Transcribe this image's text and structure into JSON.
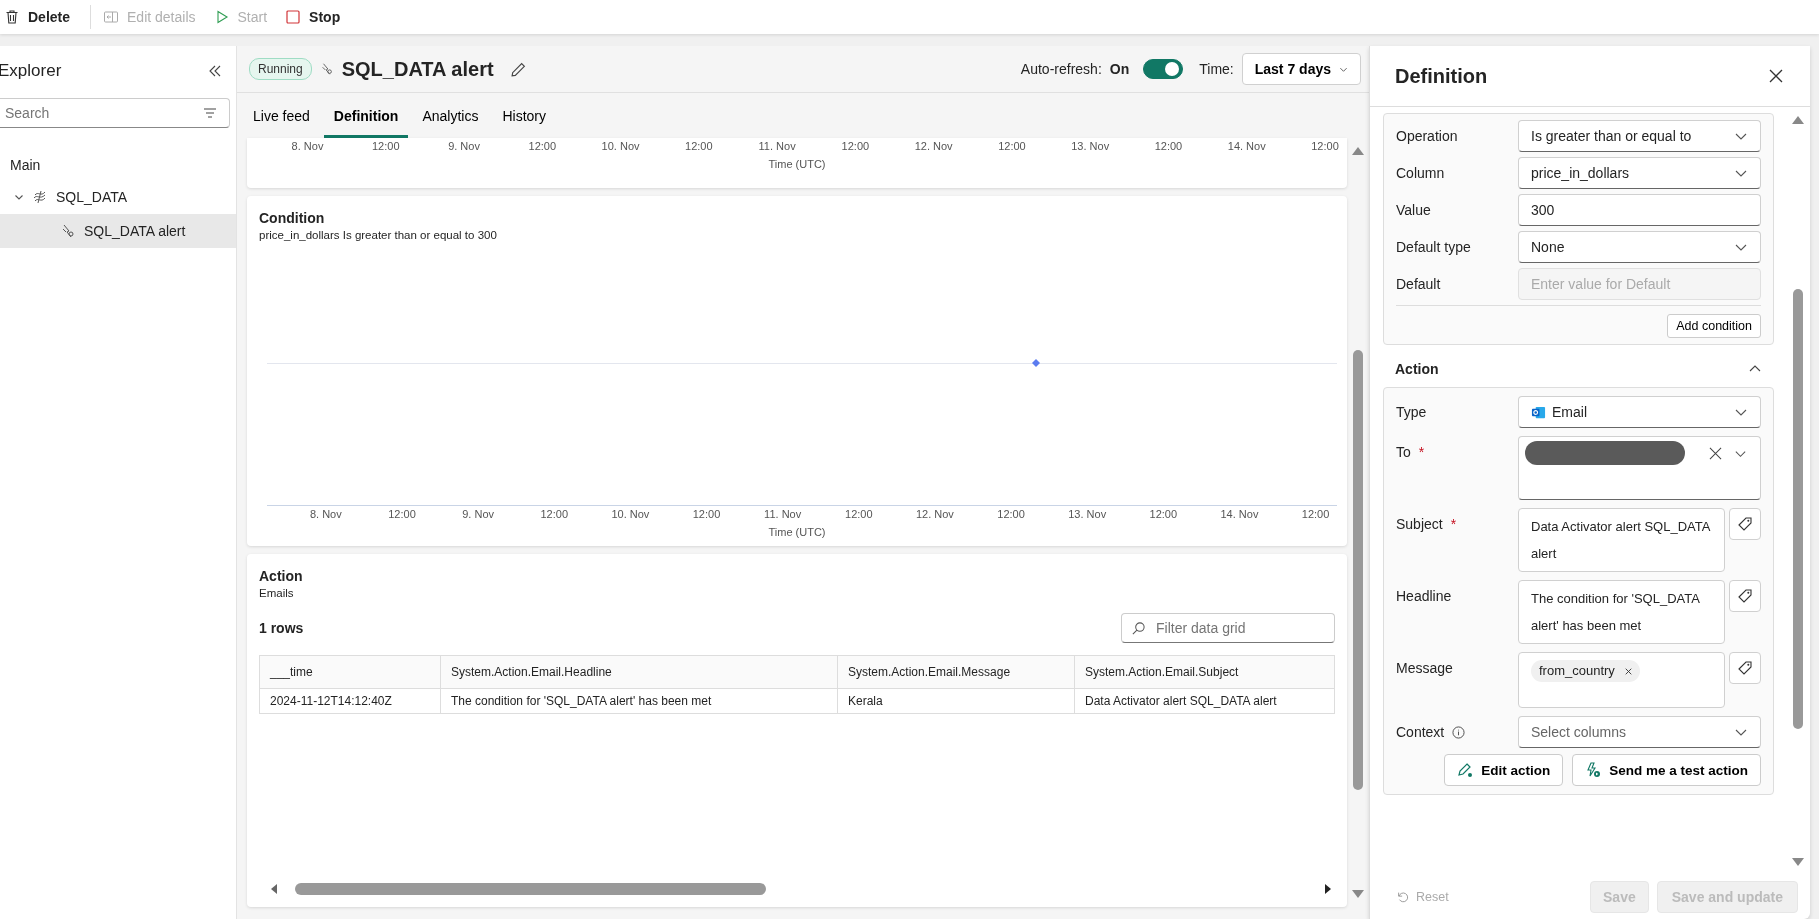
{
  "toolbar": [
    {
      "label": "Delete",
      "disabled": false
    },
    {
      "label": "Edit details",
      "disabled": true
    },
    {
      "label": "Start",
      "disabled": true
    },
    {
      "label": "Stop",
      "disabled": false
    }
  ],
  "explorer": {
    "title": "Explorer",
    "search": {
      "placeholder": "Search"
    },
    "section": "Main",
    "tree": [
      {
        "label": "SQL_DATA",
        "kind": "stream",
        "expanded": true,
        "selected": false,
        "children": [
          {
            "label": "SQL_DATA alert",
            "kind": "alert",
            "selected": true
          }
        ]
      }
    ]
  },
  "header": {
    "status": "Running",
    "title": "SQL_DATA alert",
    "auto_refresh": {
      "label": "Auto-refresh:",
      "value": "On",
      "on": true
    },
    "time": {
      "label": "Time:",
      "value": "Last 7 days"
    }
  },
  "tabs": [
    {
      "label": "Live feed",
      "selected": false
    },
    {
      "label": "Definition",
      "selected": true
    },
    {
      "label": "Analytics",
      "selected": false
    },
    {
      "label": "History",
      "selected": false
    }
  ],
  "top_chart": {
    "x_ticks": [
      "8. Nov",
      "12:00",
      "9. Nov",
      "12:00",
      "10. Nov",
      "12:00",
      "11. Nov",
      "12:00",
      "12. Nov",
      "12:00",
      "13. Nov",
      "12:00",
      "14. Nov",
      "12:00"
    ],
    "xlabel": "Time (UTC)"
  },
  "condition_card": {
    "title": "Condition",
    "description": "price_in_dollars Is greater than or equal to 300",
    "x_ticks": [
      "8. Nov",
      "12:00",
      "9. Nov",
      "12:00",
      "10. Nov",
      "12:00",
      "11. Nov",
      "12:00",
      "12. Nov",
      "12:00",
      "13. Nov",
      "12:00",
      "14. Nov",
      "12:00"
    ],
    "xlabel": "Time (UTC)"
  },
  "action_card": {
    "title": "Action",
    "subtitle": "Emails",
    "row_count": "1 rows",
    "filter": {
      "placeholder": "Filter data grid"
    },
    "table": {
      "columns": [
        "___time",
        "System.Action.Email.Headline",
        "System.Action.Email.Message",
        "System.Action.Email.Subject"
      ],
      "rows": [
        [
          "2024-11-12T14:12:40Z",
          "The condition for 'SQL_DATA alert' has been met",
          "Kerala",
          "Data Activator alert SQL_DATA alert"
        ]
      ]
    }
  },
  "definition_panel": {
    "title": "Definition",
    "condition_fields": [
      {
        "label": "Operation",
        "kind": "dropdown",
        "value": "Is greater than or equal to"
      },
      {
        "label": "Column",
        "kind": "dropdown",
        "value": "price_in_dollars"
      },
      {
        "label": "Value",
        "kind": "text",
        "value": "300"
      },
      {
        "label": "Default type",
        "kind": "dropdown",
        "value": "None"
      },
      {
        "label": "Default",
        "kind": "text",
        "placeholder": "Enter value for Default",
        "disabled": true
      }
    ],
    "add_condition": "Add condition",
    "action_section": {
      "title": "Action",
      "expanded": true,
      "fields": [
        {
          "label": "Type",
          "kind": "dropdown",
          "value": "Email"
        },
        {
          "label": "To",
          "kind": "recipients",
          "required_mark": "*"
        },
        {
          "label": "Subject",
          "kind": "textarea",
          "value": "Data Activator alert SQL_DATA alert",
          "required_mark": "*"
        },
        {
          "label": "Headline",
          "kind": "textarea",
          "value": "The condition for 'SQL_DATA alert' has been met"
        },
        {
          "label": "Message",
          "kind": "chips",
          "chips": [
            "from_country"
          ]
        },
        {
          "label": "Context",
          "kind": "dropdown",
          "placeholder": "Select columns",
          "info": true
        }
      ],
      "buttons": [
        {
          "label": "Edit action"
        },
        {
          "label": "Send me a test action"
        }
      ]
    },
    "footer": {
      "reset": {
        "label": "Reset",
        "disabled": true
      },
      "save": {
        "label": "Save",
        "disabled": true
      },
      "save_update": {
        "label": "Save and update",
        "disabled": true
      }
    }
  }
}
